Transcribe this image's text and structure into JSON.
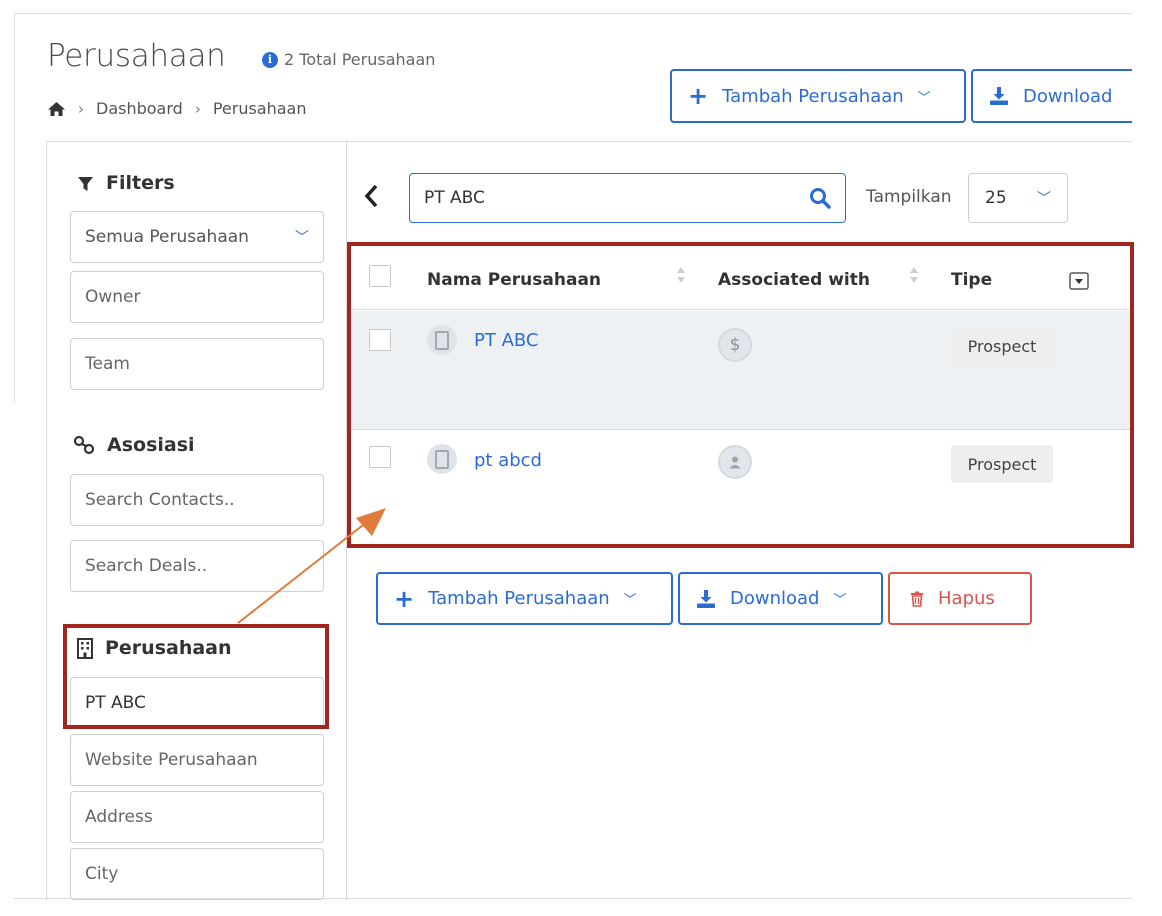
{
  "header": {
    "title": "Perusahaan",
    "total_text": "2 Total Perusahaan",
    "breadcrumb": [
      "Dashboard",
      "Perusahaan"
    ],
    "add_button": "Tambah Perusahaan",
    "download_button": "Download"
  },
  "sidebar": {
    "filters_title": "Filters",
    "company_filter": "Semua Perusahaan",
    "owner_placeholder": "Owner",
    "team_placeholder": "Team",
    "asosiasi_title": "Asosiasi",
    "search_contacts": "Search Contacts..",
    "search_deals": "Search Deals..",
    "perusahaan_title": "Perusahaan",
    "perusahaan_value": "PT ABC",
    "website_placeholder": "Website Perusahaan",
    "address_placeholder": "Address",
    "city_placeholder": "City"
  },
  "toolbar": {
    "search_value": "PT ABC",
    "show_label": "Tampilkan",
    "show_value": "25"
  },
  "table": {
    "columns": [
      "Nama Perusahaan",
      "Associated with",
      "Tipe"
    ],
    "rows": [
      {
        "name": "PT ABC",
        "associated": "deal",
        "type": "Prospect"
      },
      {
        "name": "pt abcd",
        "associated": "contact",
        "type": "Prospect"
      }
    ]
  },
  "bottom_actions": {
    "add": "Tambah Perusahaan",
    "download": "Download",
    "delete": "Hapus"
  },
  "colors": {
    "accent": "#2b6cd4",
    "danger": "#d9534f",
    "annotation_box": "#a3261e",
    "annotation_arrow": "#e07b39"
  },
  "icons": [
    "info-icon",
    "home-icon",
    "plus-icon",
    "download-icon",
    "filter-icon",
    "link-icon",
    "building-icon",
    "search-icon",
    "back-chevron-icon",
    "sort-icon",
    "column-toggle-icon",
    "dollar-icon",
    "person-icon",
    "trash-icon"
  ]
}
